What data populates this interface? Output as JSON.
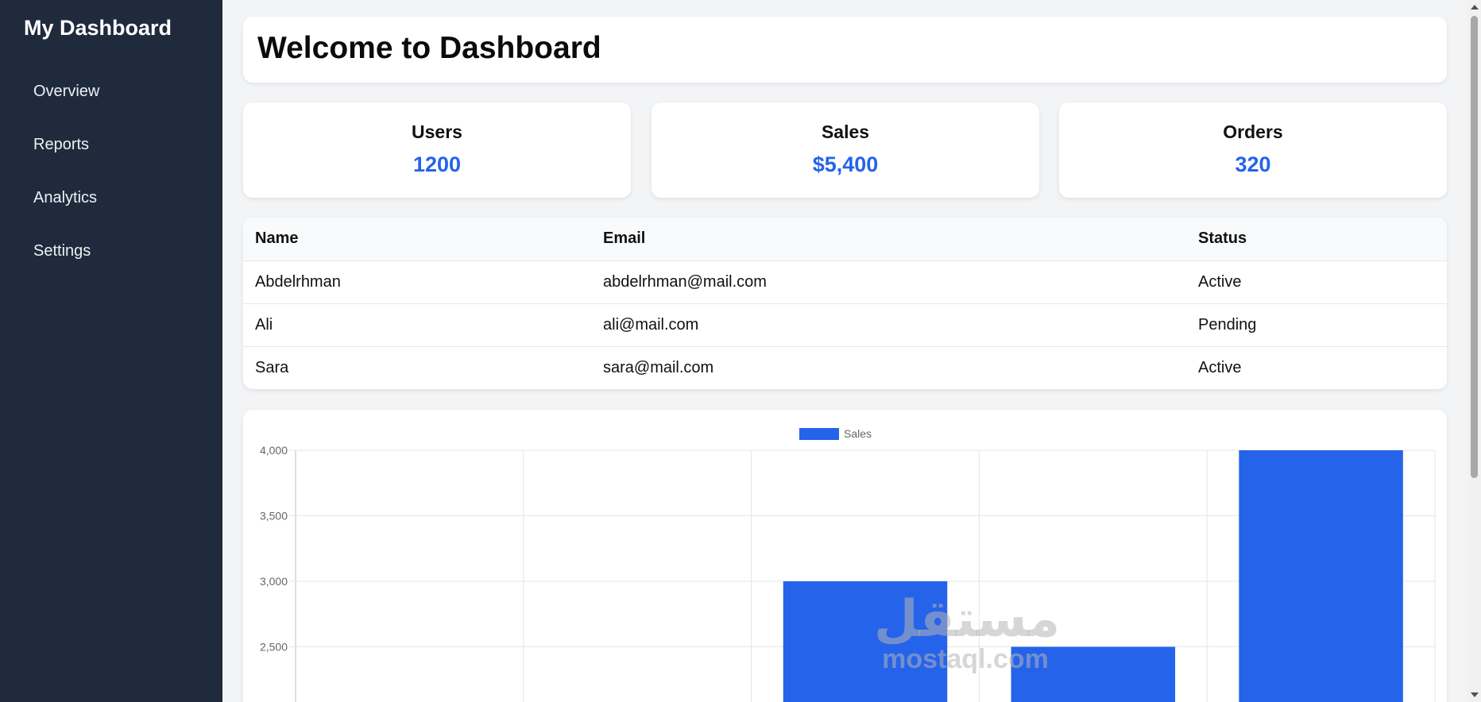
{
  "sidebar": {
    "brand": "My Dashboard",
    "items": [
      {
        "label": "Overview"
      },
      {
        "label": "Reports"
      },
      {
        "label": "Analytics"
      },
      {
        "label": "Settings"
      }
    ]
  },
  "header": {
    "title": "Welcome to Dashboard"
  },
  "stats": [
    {
      "label": "Users",
      "value": "1200"
    },
    {
      "label": "Sales",
      "value": "$5,400"
    },
    {
      "label": "Orders",
      "value": "320"
    }
  ],
  "table": {
    "columns": [
      "Name",
      "Email",
      "Status"
    ],
    "rows": [
      [
        "Abdelrhman",
        "abdelrhman@mail.com",
        "Active"
      ],
      [
        "Ali",
        "ali@mail.com",
        "Pending"
      ],
      [
        "Sara",
        "sara@mail.com",
        "Active"
      ]
    ]
  },
  "watermark": {
    "arabic": "مستقل",
    "latin": "mostaql.com"
  },
  "colors": {
    "accent": "#2563eb",
    "sidebar_bg": "#1f2a3c",
    "page_bg": "#f3f4f6"
  },
  "chart_data": {
    "type": "bar",
    "categories": [
      "",
      "",
      "",
      "",
      ""
    ],
    "series": [
      {
        "name": "Sales",
        "values": [
          null,
          null,
          3000,
          2500,
          4000
        ]
      }
    ],
    "yticks": [
      "4,000",
      "3,500",
      "3,000",
      "2,500"
    ],
    "ylim": [
      2000,
      4000
    ],
    "grid": true,
    "legend": "top-center",
    "color": "#2563eb"
  }
}
